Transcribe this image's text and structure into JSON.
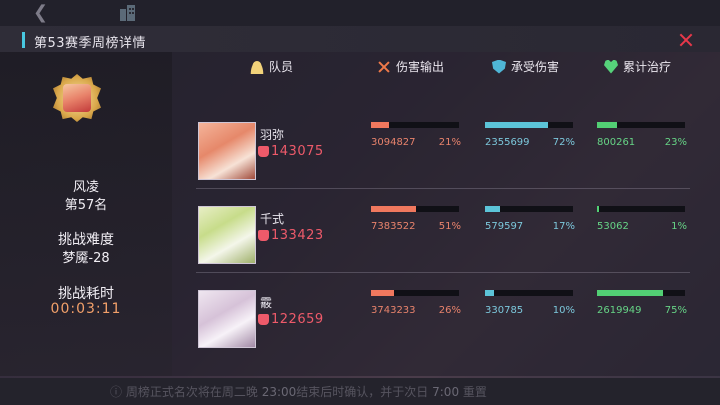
{
  "background": {
    "note_prefix": "周榜正式名次将在周二晚",
    "note_time1": "23:00",
    "note_mid": "结束后时确认，并于次日",
    "note_time2": "7:00",
    "note_suffix": "重置"
  },
  "header": {
    "title": "第53赛季周榜详情"
  },
  "player": {
    "name": "风凌",
    "rank": "第57名",
    "difficulty_label": "挑战难度",
    "difficulty_value": "梦魇-28",
    "time_label": "挑战耗时",
    "time_value": "00:03:11"
  },
  "columns": {
    "member": "队员",
    "damage": "伤害输出",
    "taken": "承受伤害",
    "heal": "累计治疗"
  },
  "members": [
    {
      "name": "羽弥",
      "power": "143075",
      "damage": {
        "value": "3094827",
        "pct": "21%",
        "ratio": 0.21
      },
      "taken": {
        "value": "2355699",
        "pct": "72%",
        "ratio": 0.72
      },
      "heal": {
        "value": "800261",
        "pct": "23%",
        "ratio": 0.23
      }
    },
    {
      "name": "千式",
      "power": "133423",
      "damage": {
        "value": "7383522",
        "pct": "51%",
        "ratio": 0.51
      },
      "taken": {
        "value": "579597",
        "pct": "17%",
        "ratio": 0.17
      },
      "heal": {
        "value": "53062",
        "pct": "1%",
        "ratio": 0.01
      }
    },
    {
      "name": "霰",
      "power": "122659",
      "damage": {
        "value": "3743233",
        "pct": "26%",
        "ratio": 0.26
      },
      "taken": {
        "value": "330785",
        "pct": "10%",
        "ratio": 0.1
      },
      "heal": {
        "value": "2619949",
        "pct": "75%",
        "ratio": 0.75
      }
    }
  ],
  "colors": {
    "damage": "#f0785e",
    "taken": "#5cc4d8",
    "heal": "#52cf74",
    "power": "#ee5a6a",
    "close": "#e8384a"
  }
}
